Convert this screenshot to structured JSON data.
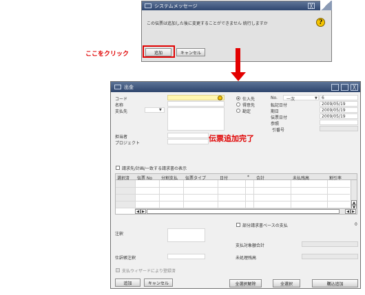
{
  "system_message": {
    "title": "システムメッセージ",
    "close_label": "╳",
    "message": "この伝票は追加した後に変更することができません 続行しますか",
    "question_glyph": "?",
    "add_label": "追加",
    "cancel_label": "キャンセル"
  },
  "callout_click": "ここをクリック",
  "callout_done": "伝票追加完了",
  "payment_window": {
    "title": "出金",
    "controls": {
      "minimize": "",
      "maximize": "",
      "close": "╳"
    },
    "left_fields": {
      "code_label": "コード",
      "name_label": "名称",
      "payee_label": "支払先",
      "person_label": "担当者",
      "project_label": "プロジェクト"
    },
    "radios": [
      {
        "label": "仕入先",
        "checked": true
      },
      {
        "label": "得意先",
        "checked": false
      },
      {
        "label": "勘定",
        "checked": false
      }
    ],
    "right_fields": {
      "no_label": "No.",
      "series": "一次",
      "number": "6",
      "posting_date_label": "転記日付",
      "posting_date": "2009/05/19",
      "due_date_label": "期日",
      "due_date": "2009/05/19",
      "doc_date_label": "伝票日付",
      "doc_date": "2009/05/19",
      "reference_label": "参照",
      "ref_number_label": "引番号"
    },
    "checkbox_label": "請求先/計画/一致する請求書の表示",
    "grid_headers": [
      "選択済",
      "伝票 No",
      "分割支払",
      "伝票タイプ",
      "日付",
      "*",
      "合計",
      "未払残高",
      "割引率"
    ],
    "partial_payment_label": "部分請求書ベースの支払",
    "partial_value": "0",
    "remarks_label": "注釈",
    "payment_total_label": "支払対象額合計",
    "memo_label": "仕訳帳注釈",
    "unprocessed_label": "未処理残高",
    "wizard_label": "支払ウィザードにより登録済",
    "buttons": {
      "add": "追加",
      "cancel": "キャンセル",
      "deselect_all": "全選択解除",
      "select_all": "全選択",
      "draft": "購込追加"
    }
  },
  "colors": {
    "accent_red": "#e00000",
    "title_blue": "#2d446c",
    "field_yellow": "#fff6b0"
  },
  "icons": [
    "question-icon",
    "window-icon",
    "close-icon",
    "radio-icon",
    "checkbox-icon",
    "dropdown-icon",
    "arrow-down-icon"
  ]
}
